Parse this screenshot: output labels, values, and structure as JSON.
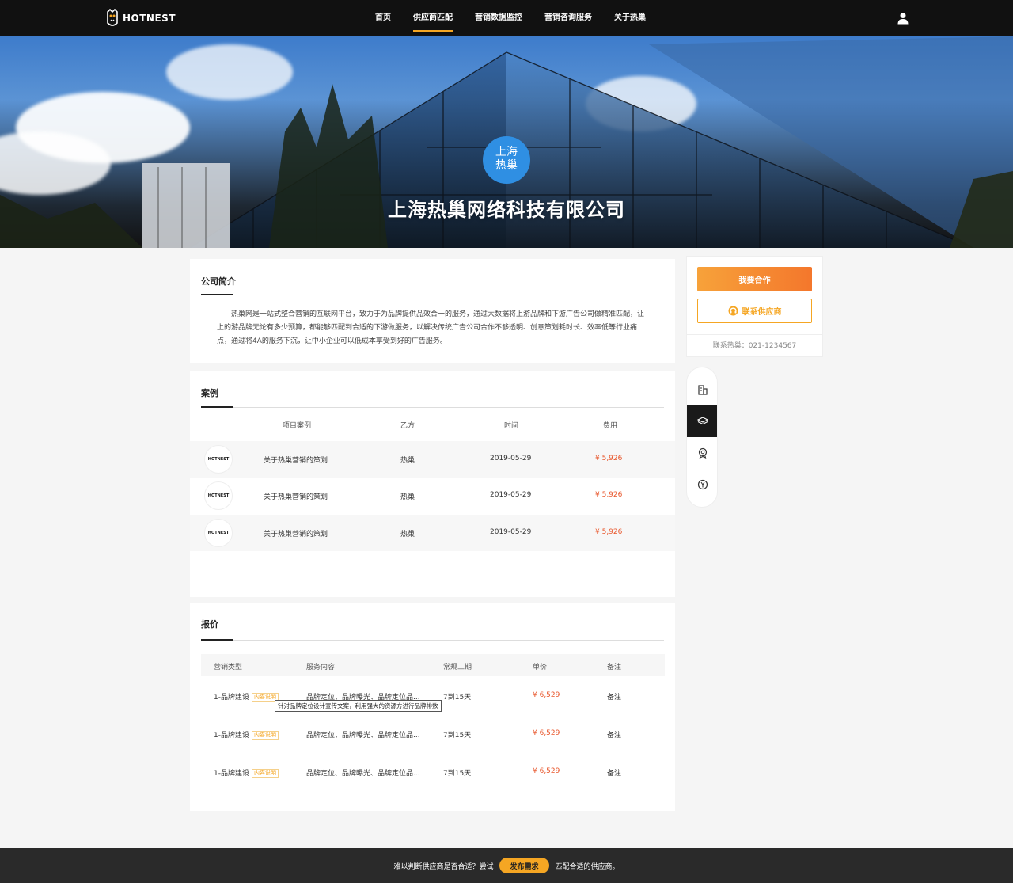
{
  "header": {
    "logo_text": "HOTNEST",
    "nav": [
      {
        "label": "首页"
      },
      {
        "label": "供应商匹配"
      },
      {
        "label": "营销数据监控"
      },
      {
        "label": "营销咨询服务"
      },
      {
        "label": "关于热巢"
      }
    ],
    "active_nav": "供应商匹配"
  },
  "banner": {
    "badge": "上海\n热巢",
    "company_name": "上海热巢网络科技有限公司"
  },
  "intro": {
    "title": "公司简介",
    "text": "热巢网是一站式整合营销的互联网平台，致力于为品牌提供品效合一的服务，通过大数据将上游品牌和下游广告公司做精准匹配，让上的游品牌无论有多少预算，都能够匹配到合适的下游做服务，以解决传统广告公司合作不够透明、创意策划耗时长、效率低等行业痛点，通过将4A的服务下沉，让中小企业可以低成本享受到好的广告服务。"
  },
  "cases": {
    "title": "案例",
    "columns": {
      "project": "项目案例",
      "party": "乙方",
      "time": "时间",
      "fee": "费用"
    },
    "rows": [
      {
        "logo": "HOTNEST",
        "project": "关于热巢营销的策划",
        "party": "热巢",
        "time": "2019-05-29",
        "fee": "¥ 5,926"
      },
      {
        "logo": "HOTNEST",
        "project": "关于热巢营销的策划",
        "party": "热巢",
        "time": "2019-05-29",
        "fee": "¥ 5,926"
      },
      {
        "logo": "HOTNEST",
        "project": "关于热巢营销的策划",
        "party": "热巢",
        "time": "2019-05-29",
        "fee": "¥ 5,926"
      }
    ]
  },
  "quotes": {
    "title": "报价",
    "columns": {
      "type": "营销类型",
      "content": "服务内容",
      "period": "常规工期",
      "price": "单价",
      "note": "备注"
    },
    "tag_label": "内容说明",
    "tooltip": "针对品牌定位设计宣传文案，利用强大的资源方进行品牌排数",
    "rows": [
      {
        "type": "1-品牌建设",
        "content": "品牌定位、品牌曝光、品牌定位品...",
        "period": "7到15天",
        "price": "¥ 6,529",
        "note": "备注"
      },
      {
        "type": "1-品牌建设",
        "content": "品牌定位、品牌曝光、品牌定位品...",
        "period": "7到15天",
        "price": "¥ 6,529",
        "note": "备注"
      },
      {
        "type": "1-品牌建设",
        "content": "品牌定位、品牌曝光、品牌定位品...",
        "period": "7到15天",
        "price": "¥ 6,529",
        "note": "备注"
      }
    ]
  },
  "sidebar": {
    "cooperate_label": "我要合作",
    "contact_label": "联系供应商",
    "hotline": "联系热巢：021-1234567",
    "tabs": [
      {
        "icon": "building-icon"
      },
      {
        "icon": "layers-icon"
      },
      {
        "icon": "award-icon"
      },
      {
        "icon": "yuan-coin-icon"
      }
    ],
    "active_tab": 1
  },
  "footer": {
    "prefix": "难以判断供应商是否合适？尝试",
    "button": "发布需求",
    "suffix": "匹配合适的供应商。"
  },
  "colors": {
    "accent": "#f5a623",
    "price": "#e8552a",
    "badge": "#2f8fe3"
  }
}
